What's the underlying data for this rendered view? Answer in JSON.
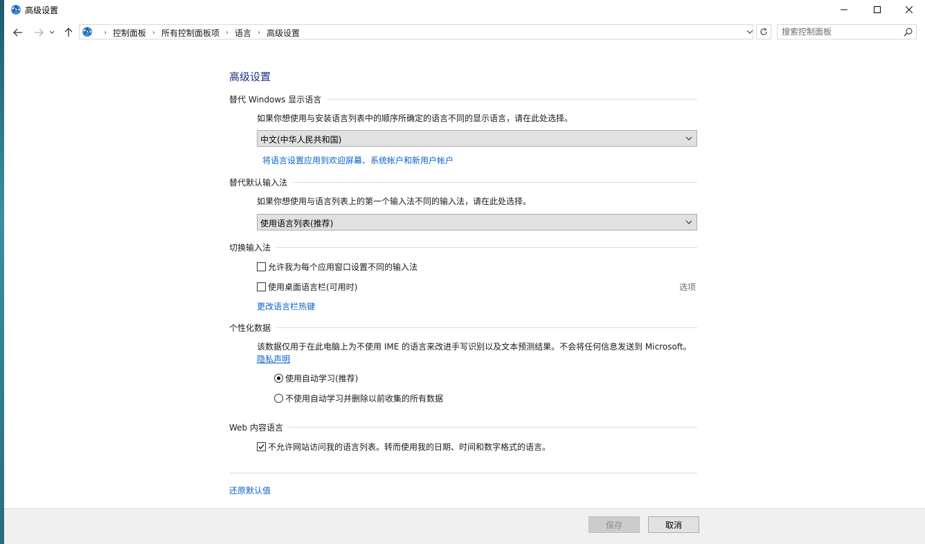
{
  "window": {
    "title": "高级设置"
  },
  "address": {
    "crumbs": [
      "控制面板",
      "所有控制面板项",
      "语言",
      "高级设置"
    ]
  },
  "search": {
    "placeholder": "搜索控制面板"
  },
  "page": {
    "title": "高级设置",
    "display_language": {
      "heading": "替代 Windows 显示语言",
      "desc": "如果你想使用与安装语言列表中的顺序所确定的语言不同的显示语言，请在此处选择。",
      "selected": "中文(中华人民共和国)",
      "apply_link": "将语言设置应用到欢迎屏幕、系统帐户和新用户帐户"
    },
    "input_method": {
      "heading": "替代默认输入法",
      "desc": "如果你想使用与语言列表上的第一个输入法不同的输入法，请在此处选择。",
      "selected": "使用语言列表(推荐)"
    },
    "switch_input": {
      "heading": "切换输入法",
      "per_app_label": "允许我为每个应用窗口设置不同的输入法",
      "per_app_checked": false,
      "desktop_bar_label": "使用桌面语言栏(可用时)",
      "desktop_bar_checked": false,
      "options_link": "选项",
      "hotkeys_link": "更改语言栏热键"
    },
    "personalization": {
      "heading": "个性化数据",
      "desc": "该数据仅用于在此电脑上为不使用 IME 的语言来改进手写识别以及文本预测结果。不会将任何信息发送到 Microsoft。",
      "privacy_link": "隐私声明",
      "radio_auto": "使用自动学习(推荐)",
      "radio_no_auto": "不使用自动学习并删除以前收集的所有数据",
      "selected": "auto"
    },
    "web_content": {
      "heading": "Web 内容语言",
      "checkbox_label": "不允许网站访问我的语言列表。转而使用我的日期、时间和数字格式的语言。",
      "checked": true
    },
    "restore_link": "还原默认值"
  },
  "footer": {
    "save_label": "保存",
    "cancel_label": "取消"
  },
  "colors": {
    "link": "#0a63c9",
    "title": "#1e3287",
    "footer_bg": "#f0f0f0"
  }
}
